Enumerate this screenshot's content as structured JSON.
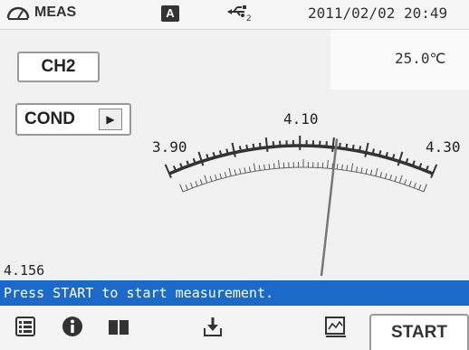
{
  "header": {
    "mode_label": "MEAS",
    "mode_icon": "gauge-icon",
    "lock_badge": "A",
    "usb_icon": "usb-icon",
    "usb_index": "2",
    "datetime": "2011/02/02 20:49"
  },
  "channel": {
    "label": "CH2"
  },
  "parameter": {
    "label": "COND",
    "arrow": "▶"
  },
  "temperature": "25.0℃",
  "meter": {
    "scale_labels": [
      "3.90",
      "4.10",
      "4.30"
    ],
    "scale_min": 3.9,
    "scale_max": 4.3,
    "needle_value": 4.156
  },
  "reading": "4.156",
  "status_message": "Press START to start measurement.",
  "toolbar": {
    "icons": [
      "list-icon",
      "info-icon",
      "book-icon",
      "save-download-icon",
      "graph-icon"
    ],
    "start_label": "START"
  },
  "colors": {
    "status_bar": "#1b69c8",
    "text": "#222222"
  }
}
